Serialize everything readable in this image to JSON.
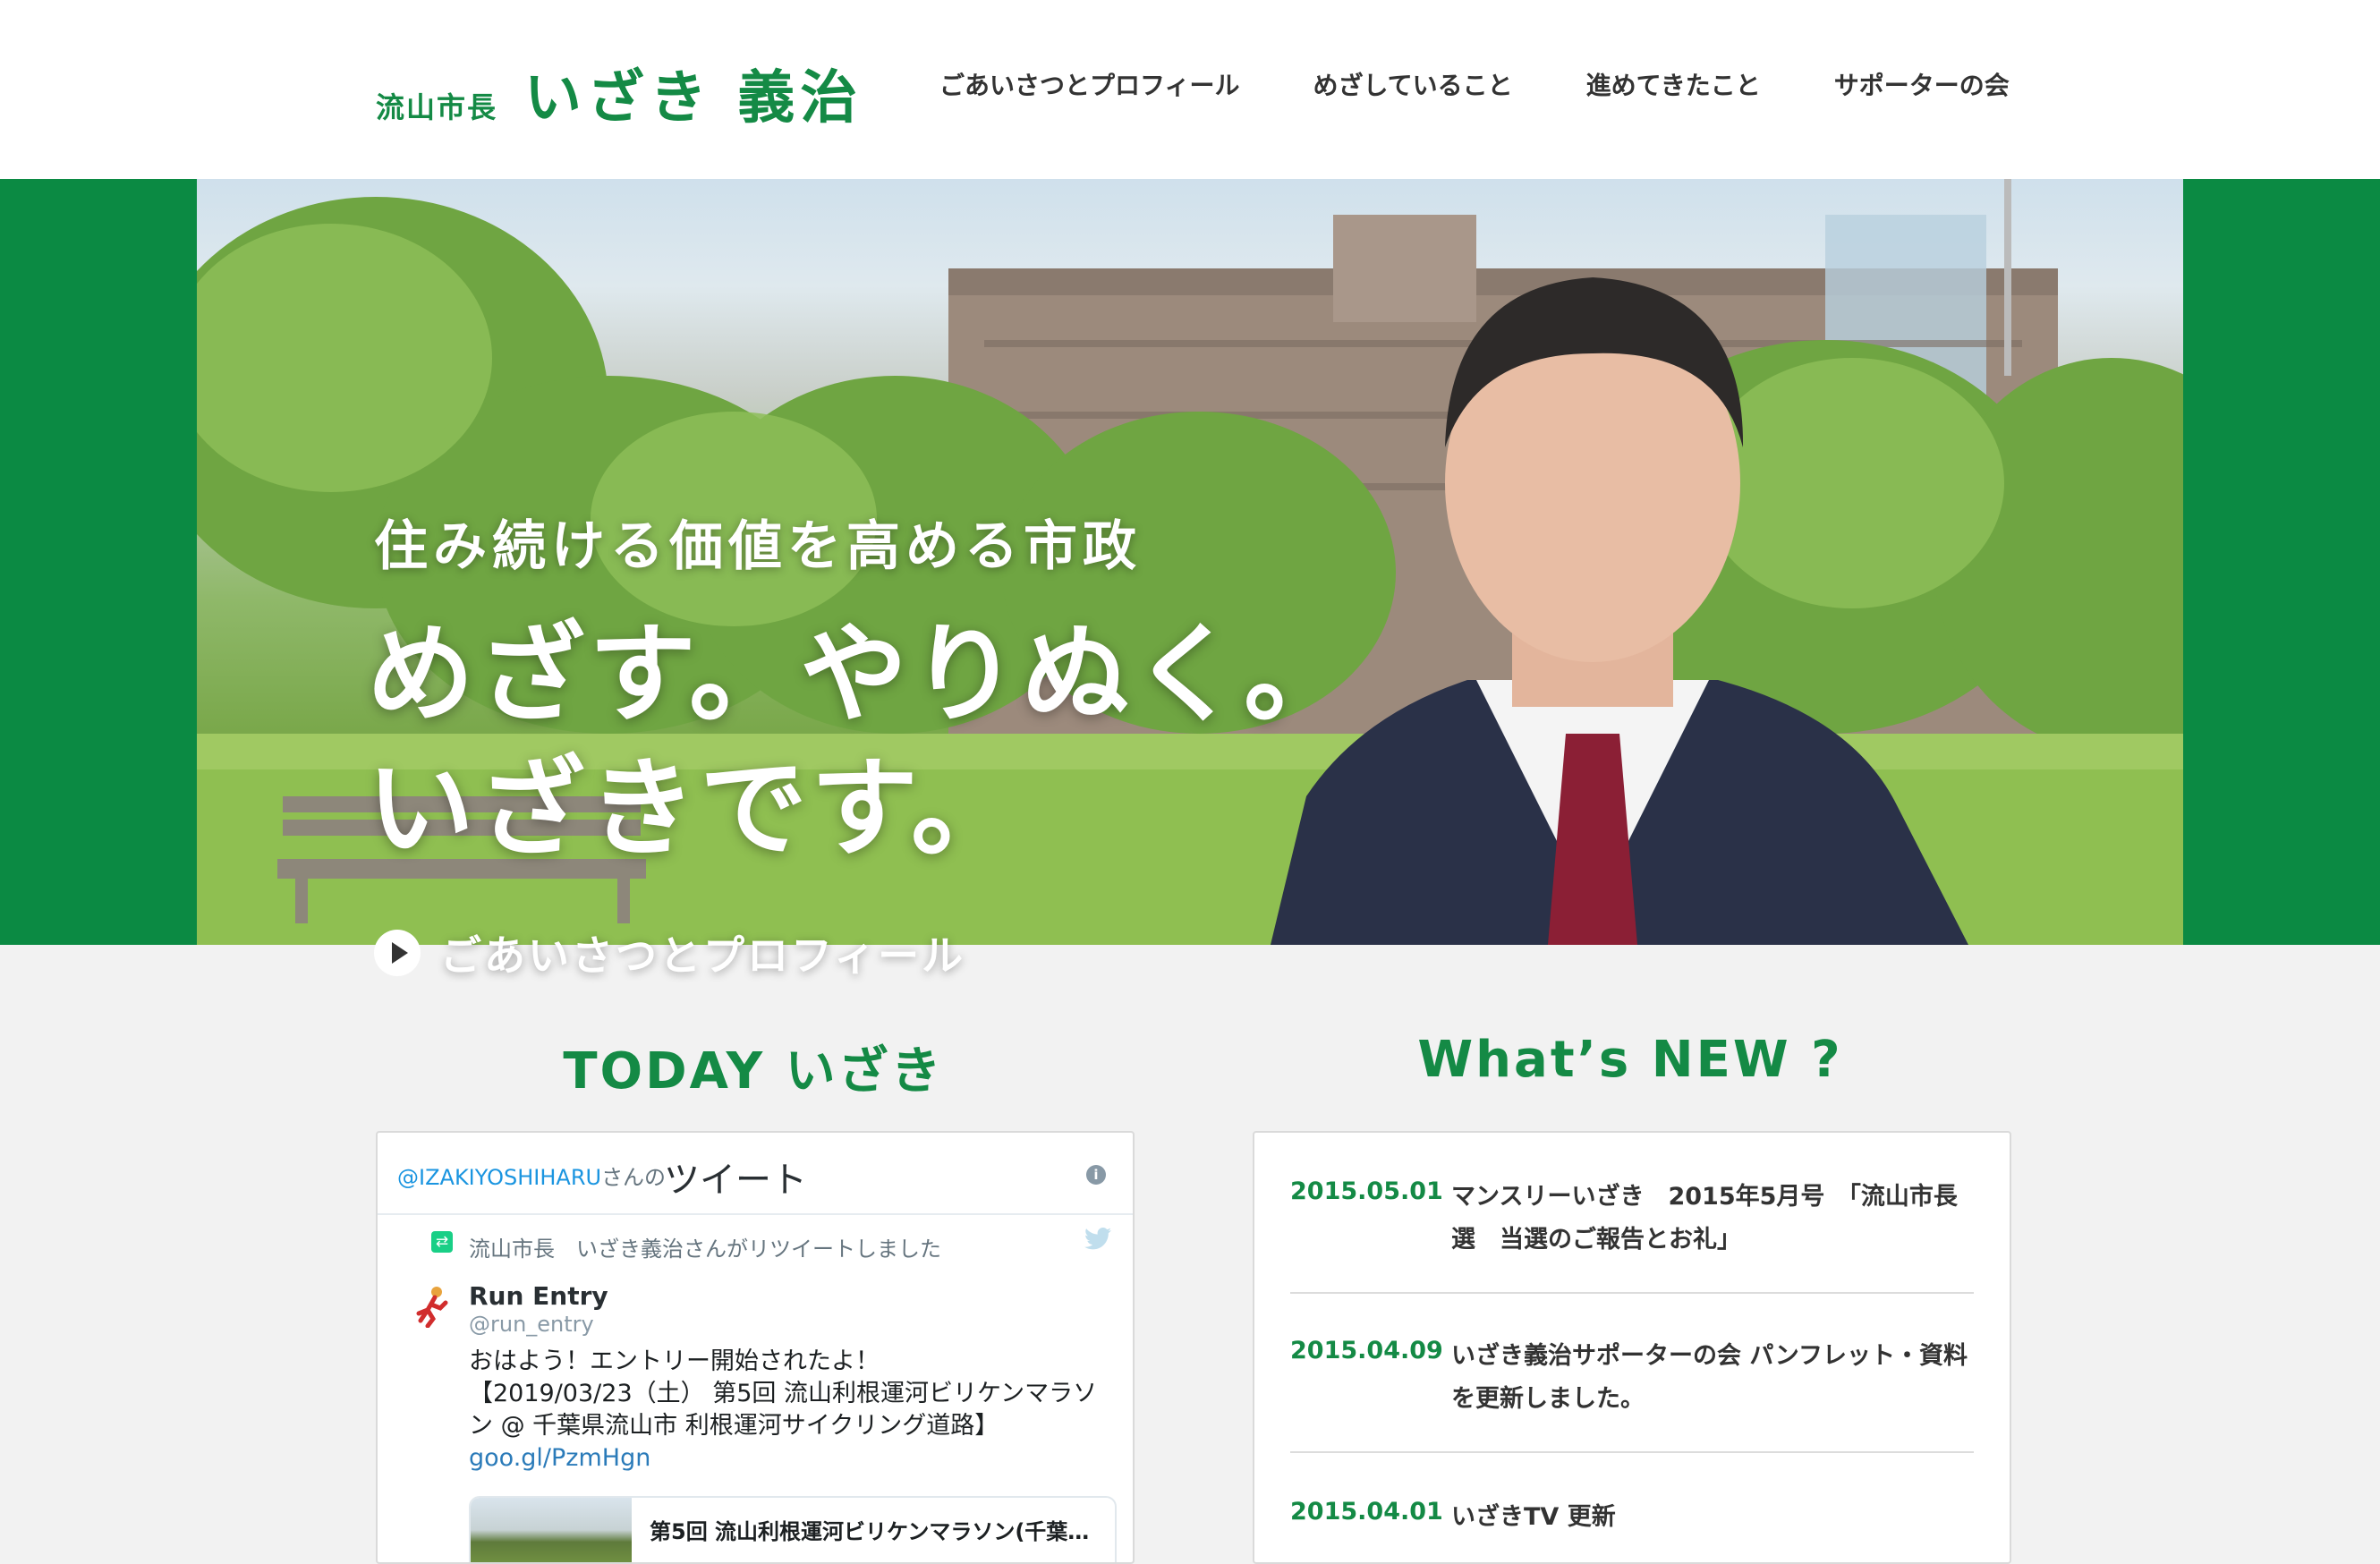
{
  "header": {
    "logo_sub": "流山市長",
    "logo_name": "いざき 義治",
    "nav": [
      {
        "label": "ごあいさつとプロフィール"
      },
      {
        "label": "めざしていること"
      },
      {
        "label": "進めてきたこと"
      },
      {
        "label": "サポーターの会"
      }
    ]
  },
  "hero": {
    "subheading": "住み続ける価値を高める市政",
    "heading_line1": "めざす。やりぬく。",
    "heading_line2": "いざきです。",
    "cta_label": "ごあいさつとプロフィール"
  },
  "sections": {
    "today_title": "TODAY いざき",
    "news_title": "What’s NEW ?"
  },
  "twitter": {
    "handle": "@IZAKIYOSHIHARU",
    "handle_suffix": "さんの",
    "title": "ツイート",
    "info_icon": "i",
    "retweet_line": "流山市長　いざき義治さんがリツイートしました",
    "author_name": "Run Entry",
    "author_handle": "@run_entry",
    "body_line1": "おはよう！エントリー開始されたよ！",
    "body_line2": "【2019/03/23（土） 第5回 流山利根運河ビリケンマラソン @ 千葉県流山市 利根運河サイクリング道路】",
    "body_link": "goo.gl/PzmHgn",
    "card_title": "第5回 流山利根運河ビリケンマラソン(千葉…"
  },
  "news": {
    "items": [
      {
        "date": "2015.05.01",
        "text": "マンスリーいざき　2015年5月号　「流山市長選　当選のご報告とお礼」"
      },
      {
        "date": "2015.04.09",
        "text": "いざき義治サポーターの会 パンフレット・資料を更新しました。"
      },
      {
        "date": "2015.04.01",
        "text": "いざきTV 更新"
      }
    ]
  },
  "colors": {
    "brand_green": "#148a45",
    "hero_band": "#0b8a43",
    "page_bg": "#f2f2f2"
  }
}
